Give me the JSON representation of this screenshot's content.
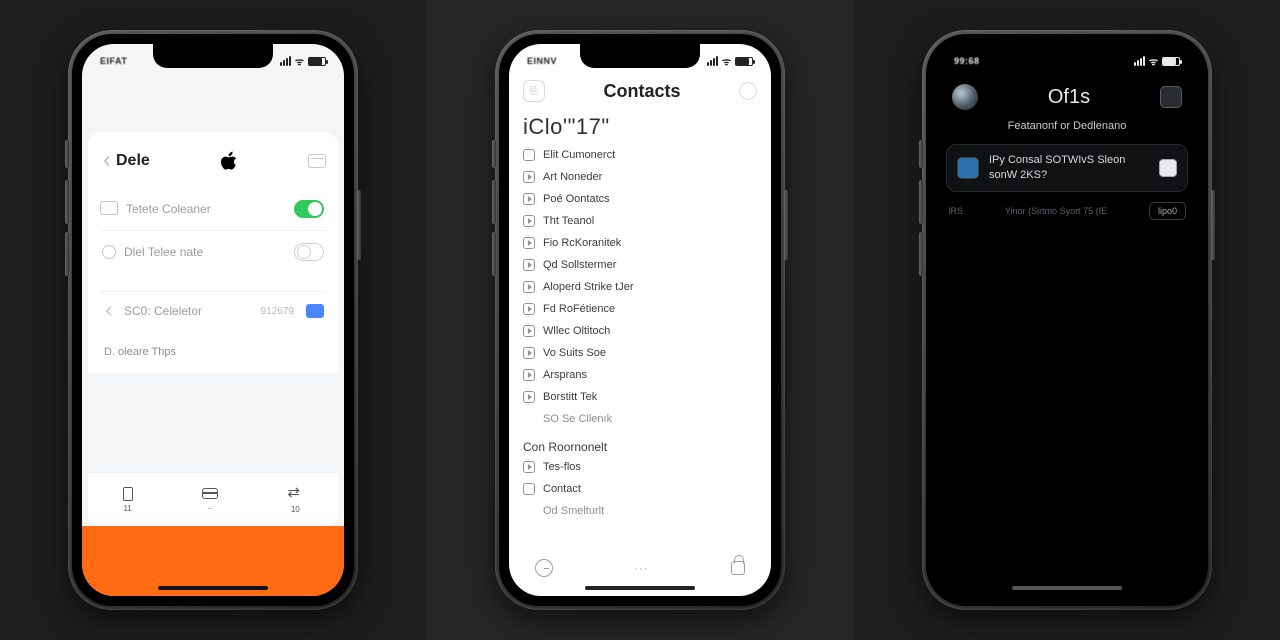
{
  "screenA": {
    "status": {
      "carrier": "EIFAT",
      "wifi_label": "WiFi",
      "signal_label": "signal"
    },
    "back_label": "Dele",
    "window_icon_name": "window-icon",
    "rows": [
      {
        "icon": "stack",
        "label": "Tetete Coleaner",
        "control": "toggle-on"
      },
      {
        "icon": "ring",
        "label": "Dlel Telee nate",
        "control": "toggle-off"
      },
      {
        "icon": "chev",
        "label": "SC0: Celeletor",
        "detail": "912679",
        "control": "chip"
      }
    ],
    "footer_note": "D. oleare Thps",
    "tabs": [
      {
        "icon": "trash",
        "label": "11"
      },
      {
        "icon": "card",
        "label": ".."
      },
      {
        "icon": "transfer",
        "label": "10"
      }
    ]
  },
  "screenB": {
    "status": {
      "carrier": "EINNV"
    },
    "left_button_glyph": "⎘",
    "title": "Contacts",
    "hero": "iClo'\"17\"",
    "items": [
      {
        "icon": "box",
        "label": "Elit Cumonerct"
      },
      {
        "icon": "play",
        "label": "Art Noneder"
      },
      {
        "icon": "play",
        "label": "Poé Oontatcs"
      },
      {
        "icon": "play",
        "label": "Tht Teanol"
      },
      {
        "icon": "play",
        "label": "Fio RcKoranitek"
      },
      {
        "icon": "play",
        "label": "Qd Sollstermer"
      },
      {
        "icon": "play",
        "label": "Aloperd Strike tJer"
      },
      {
        "icon": "play",
        "label": "Fd RoFétience"
      },
      {
        "icon": "play",
        "label": "Wllec Oltitoch"
      },
      {
        "icon": "play",
        "label": "Vo Suits Soe"
      },
      {
        "icon": "play",
        "label": "Arsprans"
      },
      {
        "icon": "play",
        "label": "Borstitt Tek"
      },
      {
        "icon": "none",
        "label": "SO Se Cllenık"
      }
    ],
    "section_header": "Con Roornonelt",
    "items2": [
      {
        "icon": "play",
        "label": "Tes-flos"
      },
      {
        "icon": "box",
        "label": "Contact"
      },
      {
        "icon": "none",
        "label": "Od Smelturlt"
      }
    ]
  },
  "screenC": {
    "status": {
      "carrier": "99:68"
    },
    "title": "Of1s",
    "subtitle": "Featanonf or Dedlenano",
    "card": {
      "line1": "IPy Consal SOTWIvS Sleon",
      "line2": "sonW 2KS?"
    },
    "footer_left_tag": "IRS",
    "footer_text": "Yinor (Sirtmo Syort 75 (IE",
    "footer_pill": "lipo0"
  }
}
